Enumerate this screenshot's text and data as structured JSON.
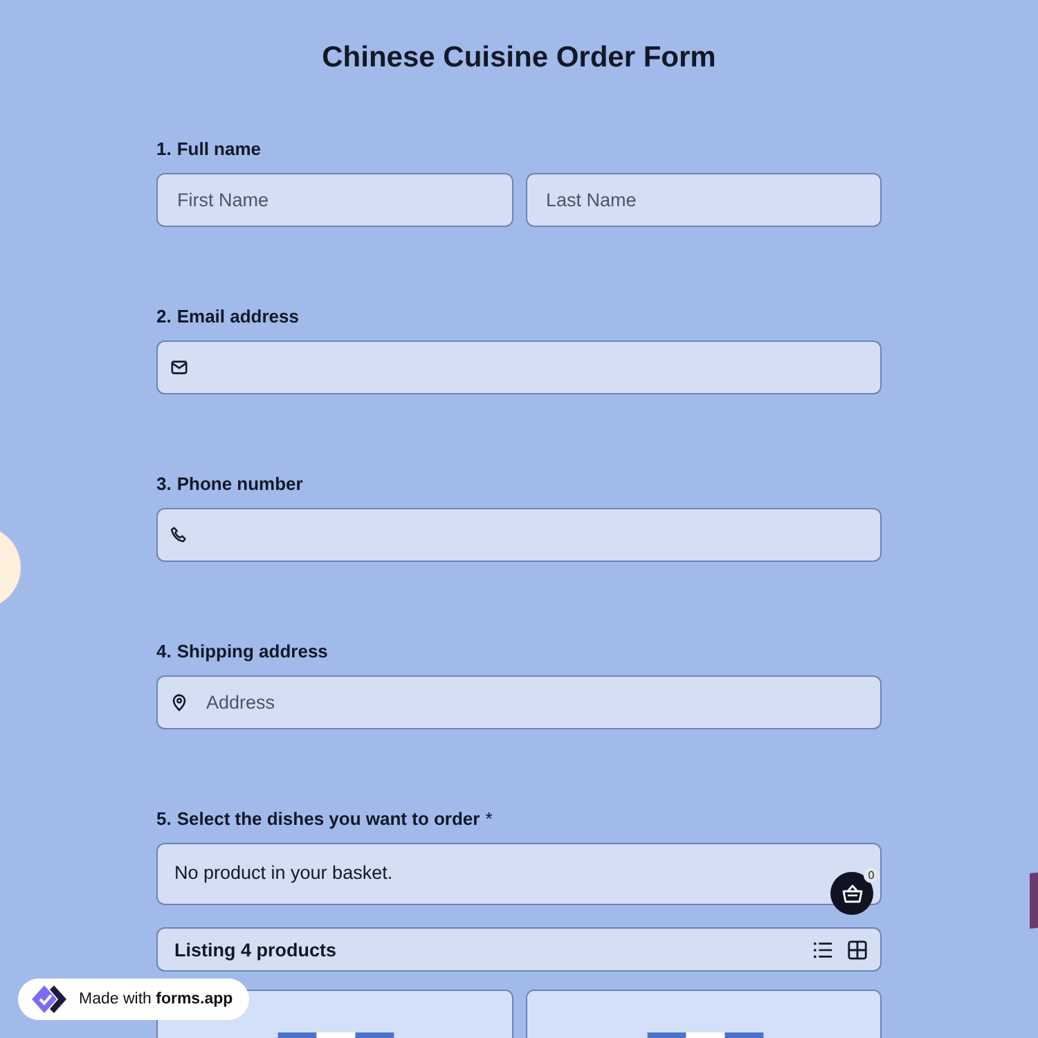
{
  "title": "Chinese Cuisine Order Form",
  "questions": [
    {
      "kind": "name",
      "number": "1.",
      "label": "Full name",
      "fields": [
        {
          "placeholder": "First Name"
        },
        {
          "placeholder": "Last Name"
        }
      ]
    },
    {
      "kind": "email",
      "number": "2.",
      "label": "Email address"
    },
    {
      "kind": "phone",
      "number": "3.",
      "label": "Phone number"
    },
    {
      "kind": "address",
      "number": "4.",
      "label": "Shipping address",
      "placeholder": "Address"
    },
    {
      "kind": "products",
      "number": "5.",
      "label": "Select the dishes you want to order",
      "required_mark": "*",
      "basket_text": "No product in your basket.",
      "basket_count": "0",
      "listing": "Listing 4 products"
    }
  ],
  "badge": "Made with **forms.app**"
}
